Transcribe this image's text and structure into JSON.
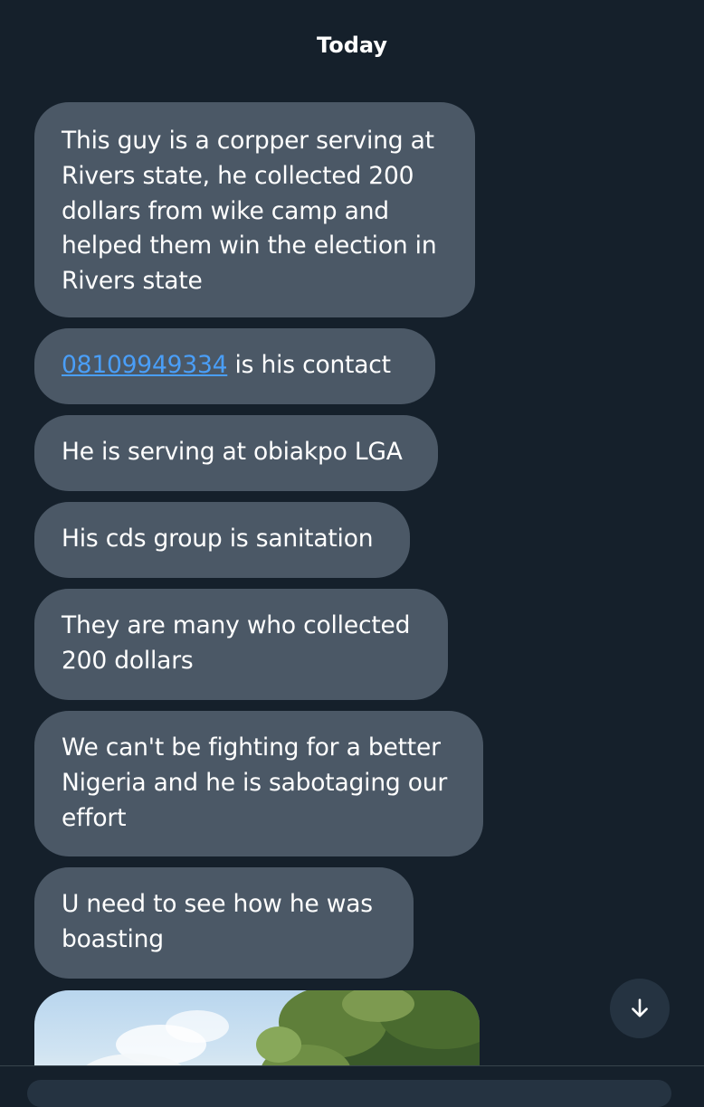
{
  "conversation": {
    "day_label": "Today",
    "messages": [
      {
        "text": "This guy is a corpper serving at Rivers state, he collected 200 dollars from wike camp and helped them win the election in Rivers state"
      },
      {
        "link_text": "08109949334",
        "text": " is his contact"
      },
      {
        "text": "He is serving at obiakpo LGA"
      },
      {
        "text": "His cds group is sanitation"
      },
      {
        "text": "They are many who collected 200 dollars"
      },
      {
        "text": "We can't be fighting for a better Nigeria and he is sabotaging our effort"
      },
      {
        "text": "U need to see how he was boasting"
      }
    ]
  },
  "icons": {
    "scroll_down": "arrow-down-icon"
  },
  "colors": {
    "background": "#15202b",
    "bubble": "#4b5866",
    "link": "#4a9ef7",
    "scroll_button": "#253341"
  }
}
